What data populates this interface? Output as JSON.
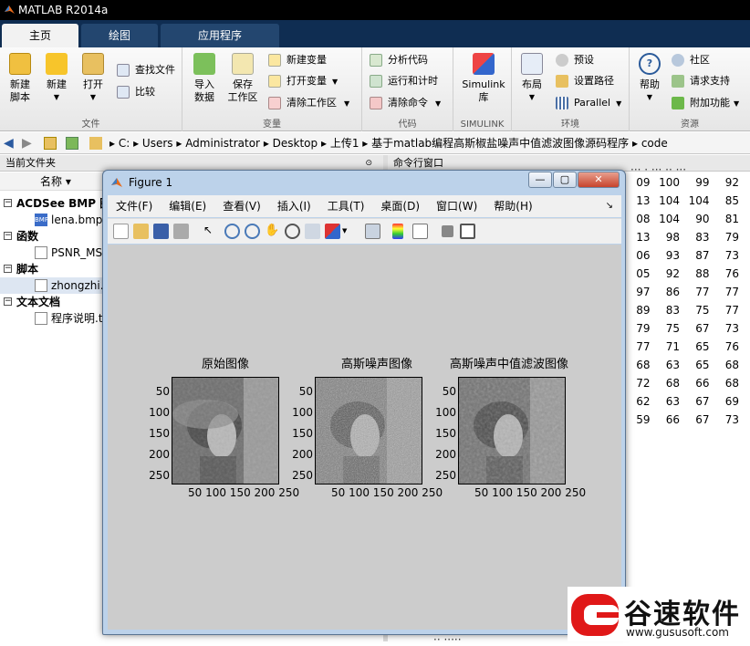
{
  "app": {
    "title": "MATLAB R2014a"
  },
  "tabs": [
    "主页",
    "绘图",
    "应用程序"
  ],
  "ribbon": {
    "new_script": "新建\n脚本",
    "new": "新建",
    "open": "打开",
    "find_files": "查找文件",
    "compare": "比较",
    "file_group": "文件",
    "import": "导入\n数据",
    "save_ws": "保存\n工作区",
    "new_var": "新建变量",
    "open_var": "打开变量",
    "clear_ws": "清除工作区",
    "var_group": "变量",
    "analyze": "分析代码",
    "run_time": "运行和计时",
    "clear_cmd": "清除命令",
    "code_group": "代码",
    "simulink": "Simulink\n库",
    "simulink_group": "SIMULINK",
    "layout": "布局",
    "prefs": "预设",
    "set_path": "设置路径",
    "parallel": "Parallel",
    "env_group": "环境",
    "help": "帮助",
    "community": "社区",
    "support": "请求支持",
    "addons": "附加功能",
    "res_group": "资源"
  },
  "address": {
    "parts": [
      "C:",
      "Users",
      "Administrator",
      "Desktop",
      "上传1",
      "基于matlab编程高斯椒盐噪声中值滤波图像源码程序",
      "code"
    ]
  },
  "current_folder": {
    "title": "当前文件夹",
    "col_name": "名称 ▾",
    "groups": [
      {
        "label": "ACDSee BMP 图",
        "files": [
          "lena.bmp"
        ]
      },
      {
        "label": "函数",
        "files": [
          "PSNR_MS"
        ]
      },
      {
        "label": "脚本",
        "files": [
          "zhongzhi."
        ]
      },
      {
        "label": "文本文档",
        "files": [
          "程序说明.t"
        ]
      }
    ]
  },
  "command_window": {
    "title": "命令行窗口",
    "rows": [
      [
        "09",
        "100",
        "99",
        "92"
      ],
      [
        "13",
        "104",
        "104",
        "85"
      ],
      [
        "08",
        "104",
        "90",
        "81"
      ],
      [
        "13",
        "98",
        "83",
        "79"
      ],
      [
        "06",
        "93",
        "87",
        "73"
      ],
      [
        "05",
        "92",
        "88",
        "76"
      ],
      [
        "97",
        "86",
        "77",
        "77"
      ],
      [
        "89",
        "83",
        "75",
        "77"
      ],
      [
        "79",
        "75",
        "67",
        "73"
      ],
      [
        "77",
        "71",
        "65",
        "76"
      ],
      [
        "68",
        "63",
        "65",
        "68"
      ],
      [
        "72",
        "68",
        "66",
        "68"
      ],
      [
        "62",
        "63",
        "67",
        "69"
      ],
      [
        "59",
        "66",
        "67",
        "73"
      ]
    ],
    "partial_top": "··· ·  ···  ··  ···",
    "partial_bottom": "··  ·····"
  },
  "figure": {
    "title": "Figure 1",
    "menu": [
      "文件(F)",
      "编辑(E)",
      "查看(V)",
      "插入(I)",
      "工具(T)",
      "桌面(D)",
      "窗口(W)",
      "帮助(H)"
    ],
    "menu_arrow": "↘",
    "win_min": "—",
    "win_max": "▢",
    "win_close": "✕",
    "plots": [
      {
        "title": "原始图像",
        "yticks": [
          "50",
          "100",
          "150",
          "200",
          "250"
        ],
        "xticks": "50  100 150 200 250"
      },
      {
        "title": "高斯噪声图像",
        "yticks": [
          "50",
          "100",
          "150",
          "200",
          "250"
        ],
        "xticks": "50  100 150 200 250"
      },
      {
        "title": "高斯噪声中值滤波图像",
        "yticks": [
          "50",
          "100",
          "150",
          "200",
          "250"
        ],
        "xticks": "50  100 150 200 250"
      }
    ]
  },
  "watermark": {
    "text": "谷速软件",
    "url": "www.gususoft.com"
  }
}
